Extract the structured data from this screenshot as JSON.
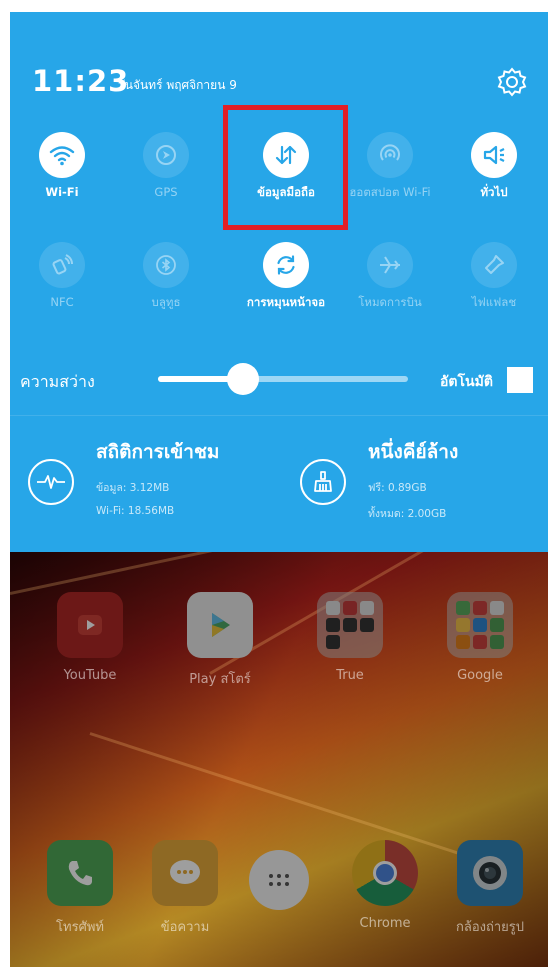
{
  "status": {
    "time": "11:23",
    "date": "วันจันทร์ พฤศจิกายน 9"
  },
  "quick_settings": {
    "row1": [
      {
        "label": "Wi-Fi",
        "icon": "wifi-icon",
        "state": "on"
      },
      {
        "label": "GPS",
        "icon": "gps-icon",
        "state": "off"
      },
      {
        "label": "ข้อมูลมือถือ",
        "icon": "mobile-data-icon",
        "state": "on"
      },
      {
        "label": "ฮอตสปอต Wi-Fi",
        "icon": "hotspot-icon",
        "state": "off"
      },
      {
        "label": "ทั่วไป",
        "icon": "speaker-icon",
        "state": "on"
      }
    ],
    "row2": [
      {
        "label": "NFC",
        "icon": "nfc-icon",
        "state": "off"
      },
      {
        "label": "บลูทูธ",
        "icon": "bluetooth-icon",
        "state": "off"
      },
      {
        "label": "การหมุนหน้าจอ",
        "icon": "rotate-icon",
        "state": "on"
      },
      {
        "label": "โหมดการบิน",
        "icon": "airplane-icon",
        "state": "off"
      },
      {
        "label": "ไฟแฟลช",
        "icon": "flashlight-icon",
        "state": "off"
      }
    ]
  },
  "brightness": {
    "label": "ความสว่าง",
    "level": 0.34,
    "auto_label": "อัตโนมัติ",
    "auto_checked": false
  },
  "stats": {
    "usage": {
      "title": "สถิติการเข้าชม",
      "line1": "ข้อมูล: 3.12MB",
      "line2": "Wi-Fi: 18.56MB"
    },
    "clean": {
      "title": "หนึ่งคีย์ล้าง",
      "line1": "ฟรี: 0.89GB",
      "line2": "ทั้งหมด: 2.00GB"
    }
  },
  "home": {
    "apps": [
      {
        "name": "YouTube",
        "icon": "youtube-icon"
      },
      {
        "name": "Play สโตร์",
        "icon": "play-store-icon"
      },
      {
        "name": "True",
        "icon": "folder-icon"
      },
      {
        "name": "Google",
        "icon": "folder-icon"
      }
    ],
    "dock": [
      {
        "name": "โทรศัพท์",
        "icon": "phone-icon"
      },
      {
        "name": "ข้อความ",
        "icon": "messages-icon"
      },
      {
        "name": "",
        "icon": "app-drawer-icon"
      },
      {
        "name": "Chrome",
        "icon": "chrome-icon"
      },
      {
        "name": "กล้องถ่ายรูป",
        "icon": "camera-icon"
      }
    ]
  },
  "colors": {
    "shade_bg": "#27a6e8",
    "highlight": "#e21f26"
  }
}
